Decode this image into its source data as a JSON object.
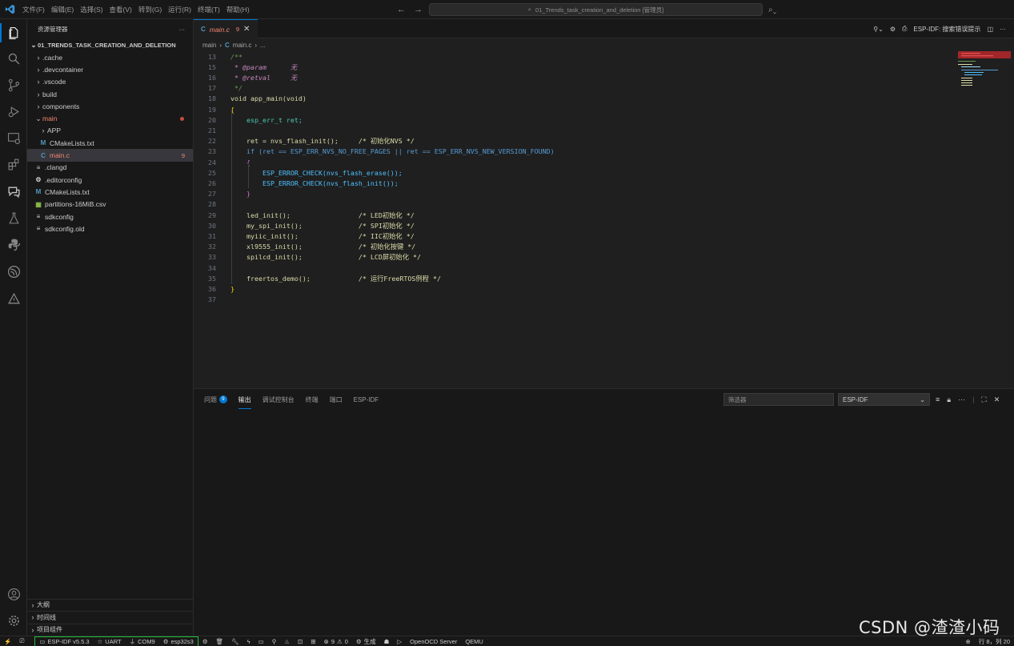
{
  "titlebar": {
    "menu": [
      "文件(F)",
      "编辑(E)",
      "选择(S)",
      "查看(V)",
      "转到(G)",
      "运行(R)",
      "终端(T)",
      "帮助(H)"
    ],
    "search_text": "01_Trends_task_creation_and_deletion [管理员]"
  },
  "sidebar": {
    "header": "资源管理器",
    "more": "···",
    "project": "01_TRENDS_TASK_CREATION_AND_DELETION",
    "items": [
      {
        "label": ".cache",
        "chev": "›"
      },
      {
        "label": ".devcontainer",
        "chev": "›"
      },
      {
        "label": ".vscode",
        "chev": "›"
      },
      {
        "label": "build",
        "chev": "›"
      },
      {
        "label": "components",
        "chev": "›"
      },
      {
        "label": "main",
        "chev": "⌄"
      },
      {
        "label": "APP",
        "chev": "›"
      },
      {
        "label": "CMakeLists.txt",
        "icon": "M"
      },
      {
        "label": "main.c",
        "icon": "C",
        "badge": "9"
      },
      {
        "label": ".clangd",
        "icon": "≡"
      },
      {
        "label": ".editorconfig",
        "icon": "⚙"
      },
      {
        "label": "CMakeLists.txt",
        "icon": "M"
      },
      {
        "label": "partitions-16MiB.csv",
        "icon": "▦"
      },
      {
        "label": "sdkconfig",
        "icon": "≡"
      },
      {
        "label": "sdkconfig.old",
        "icon": "≡"
      }
    ],
    "bottom": [
      "大纲",
      "时间线",
      "项目组件"
    ]
  },
  "editor": {
    "tab": {
      "name": "main.c",
      "problems": "9",
      "icon": "C"
    },
    "actions_label": "ESP-IDF: 搜索错误提示",
    "breadcrumb": [
      "main",
      "main.c",
      "..."
    ],
    "lines": [
      {
        "n": "13",
        "code": "/**"
      },
      {
        "n": "15",
        "code": " * @param      无"
      },
      {
        "n": "16",
        "code": " * @retval     无"
      },
      {
        "n": "17",
        "code": " */"
      },
      {
        "n": "18",
        "code": "void app_main(void)"
      },
      {
        "n": "19",
        "code": "{"
      },
      {
        "n": "20",
        "code": "    esp_err_t ret;"
      },
      {
        "n": "21",
        "code": ""
      },
      {
        "n": "22",
        "code": "    ret = nvs_flash_init();     /* 初始化NVS */"
      },
      {
        "n": "23",
        "code": "    if (ret == ESP_ERR_NVS_NO_FREE_PAGES || ret == ESP_ERR_NVS_NEW_VERSION_FOUND)"
      },
      {
        "n": "24",
        "code": "    {"
      },
      {
        "n": "25",
        "code": "        ESP_ERROR_CHECK(nvs_flash_erase());"
      },
      {
        "n": "26",
        "code": "        ESP_ERROR_CHECK(nvs_flash_init());"
      },
      {
        "n": "27",
        "code": "    }"
      },
      {
        "n": "28",
        "code": ""
      },
      {
        "n": "29",
        "code": "    led_init();                 /* LED初始化 */"
      },
      {
        "n": "30",
        "code": "    my_spi_init();              /* SPI初始化 */"
      },
      {
        "n": "31",
        "code": "    myiic_init();               /* IIC初始化 */"
      },
      {
        "n": "32",
        "code": "    xl9555_init();              /* 初始化按键 */"
      },
      {
        "n": "33",
        "code": "    spilcd_init();              /* LCD屏初始化 */"
      },
      {
        "n": "34",
        "code": ""
      },
      {
        "n": "35",
        "code": "    freertos_demo();            /* 运行FreeRTOS例程 */"
      },
      {
        "n": "36",
        "code": "}"
      },
      {
        "n": "37",
        "code": ""
      }
    ]
  },
  "panel": {
    "tabs": [
      "问题",
      "输出",
      "调试控制台",
      "终端",
      "端口",
      "ESP-IDF"
    ],
    "problems_count": "9",
    "filter_placeholder": "筛选器",
    "output_channel": "ESP-IDF"
  },
  "statusbar": {
    "idf_version": "ESP-IDF v5.5.3",
    "flash_method": "UART",
    "port": "COM9",
    "target": "esp32s3",
    "errors": "9",
    "warnings": "0",
    "build": "生成",
    "openocd": "OpenOCD Server",
    "qemu": "QEMU",
    "cursor": "行 8，列 20"
  },
  "watermark": "CSDN @渣渣小码",
  "colors": {
    "accent": "#0078d4",
    "error": "#f48771",
    "highlight_border": "#1fbf3a"
  }
}
